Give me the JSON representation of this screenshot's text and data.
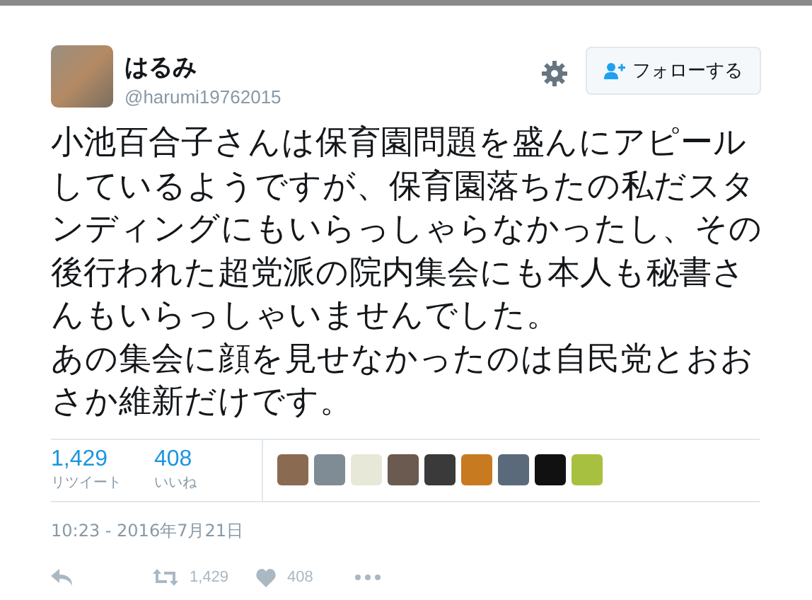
{
  "tweet": {
    "author": {
      "name": "はるみ",
      "handle": "@harumi19762015"
    },
    "follow_button": {
      "label": "フォローする"
    },
    "paragraphs": [
      "小池百合子さんは保育園問題を盛んにアピールしているようですが、保育園落ちたの私だスタンディングにもいらっしゃらなかったし、その後行われた超党派の院内集会にも本人も秘書さんもいらっしゃいませんでした。",
      "あの集会に顔を見せなかったのは自民党とおおさか維新だけです。"
    ],
    "stats": [
      {
        "count": "1,429",
        "label": "リツイート"
      },
      {
        "count": "408",
        "label": "いいね"
      }
    ],
    "likers": [
      {
        "color": "#8a6a50"
      },
      {
        "color": "#7f8c95"
      },
      {
        "color": "#e8e8d8"
      },
      {
        "color": "#6a5a50"
      },
      {
        "color": "#3a3a3a"
      },
      {
        "color": "#c87a20"
      },
      {
        "color": "#5a6a7a"
      },
      {
        "color": "#111111"
      },
      {
        "color": "#a8c040"
      }
    ],
    "timestamp": "10:23 - 2016年7月21日",
    "actions": [
      {
        "kind": "reply"
      },
      {
        "kind": "retweet",
        "count": "1,429"
      },
      {
        "kind": "like",
        "count": "408"
      },
      {
        "kind": "more"
      }
    ]
  }
}
